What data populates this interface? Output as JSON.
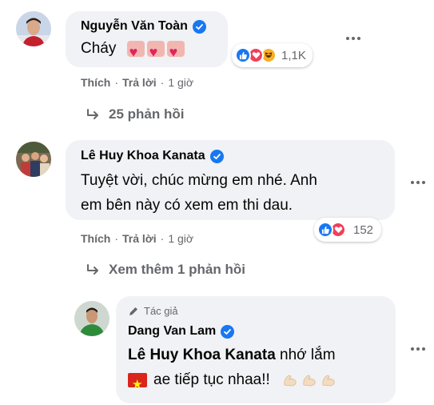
{
  "comments": [
    {
      "author": "Nguyễn Văn Toàn",
      "text": "Cháy",
      "reaction_count": "1,1K",
      "actions": {
        "like": "Thích",
        "reply": "Trả lời",
        "time": "1 giờ"
      },
      "replies_link": "25 phản hồi"
    },
    {
      "author": "Lê Huy Khoa Kanata",
      "text_line1": "Tuyệt vời, chúc mừng em nhé. Anh",
      "text_line2": "em bên này có xem em thi dau.",
      "reaction_count": "152",
      "actions": {
        "like": "Thích",
        "reply": "Trả lời",
        "time": "1 giờ"
      },
      "replies_link": "Xem thêm 1 phản hồi"
    }
  ],
  "reply": {
    "author_tag": "Tác giả",
    "author": "Dang Van Lam",
    "mention": "Lê Huy Khoa Kanata",
    "text_line1_rest": " nhớ lắm",
    "text_line2": "ae tiếp tục nhaa!!"
  },
  "colors": {
    "bubble": "#f0f2f5",
    "meta_text": "#65676b",
    "verified": "#1877f2",
    "like": "#1877f2",
    "love": "#f33e58",
    "haha": "#f7b125"
  }
}
